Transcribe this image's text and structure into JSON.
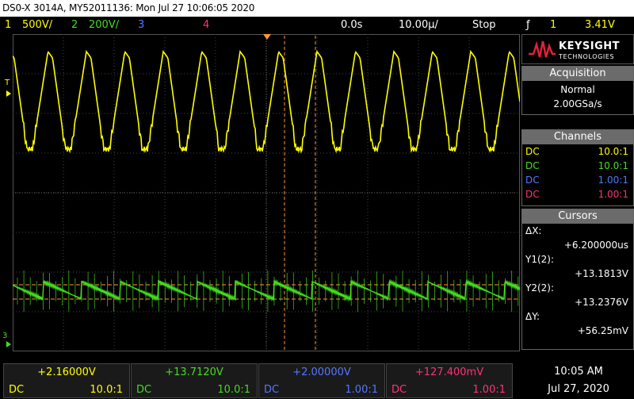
{
  "title_bar": {
    "text": "DS0-X 3014A, MY52011136: Mon Jul 27 10:06:05 2020"
  },
  "status": {
    "ch1_num": "1",
    "ch1_scale": "500V/",
    "ch2_num": "2",
    "ch2_scale": "200V/",
    "ch3_num": "3",
    "ch4_num": "4",
    "time_pos": "0.0s",
    "time_scale": "10.00µ/",
    "run_state": "Stop",
    "trig_icon": "ƒ",
    "trig_ch": "1",
    "trig_level": "3.41V"
  },
  "colors": {
    "ch1": "#ffff00",
    "ch2": "#44dd22",
    "ch3": "#5577ff",
    "ch4": "#ff3377",
    "cursor": "#ff9933"
  },
  "brand": {
    "name": "KEYSIGHT",
    "sub": "TECHNOLOGIES"
  },
  "acquisition": {
    "header": "Acquisition",
    "mode": "Normal",
    "rate": "2.00GSa/s"
  },
  "channels": {
    "header": "Channels",
    "rows": [
      {
        "coupling": "DC",
        "probe": "10.0:1"
      },
      {
        "coupling": "DC",
        "probe": "10.0:1"
      },
      {
        "coupling": "DC",
        "probe": "1.00:1"
      },
      {
        "coupling": "DC",
        "probe": "1.00:1"
      }
    ]
  },
  "cursors": {
    "header": "Cursors",
    "dx_label": "ΔX:",
    "dx_value": "+6.200000us",
    "y1_label": "Y1(2):",
    "y1_value": "+13.1813V",
    "y2_label": "Y2(2):",
    "y2_value": "+13.2376V",
    "dy_label": "ΔY:",
    "dy_value": "+56.25mV"
  },
  "bottom": [
    {
      "value": "+2.16000V",
      "coupling": "DC",
      "probe": "10.0:1"
    },
    {
      "value": "+13.7120V",
      "coupling": "DC",
      "probe": "10.0:1"
    },
    {
      "value": "+2.00000V",
      "coupling": "DC",
      "probe": "1.00:1"
    },
    {
      "value": "+127.400mV",
      "coupling": "DC",
      "probe": "1.00:1"
    }
  ],
  "clock": {
    "time": "10:05 AM",
    "date": "Jul 27, 2020"
  },
  "markers": {
    "trig_marker": "T",
    "gnd_marker": "3"
  }
}
